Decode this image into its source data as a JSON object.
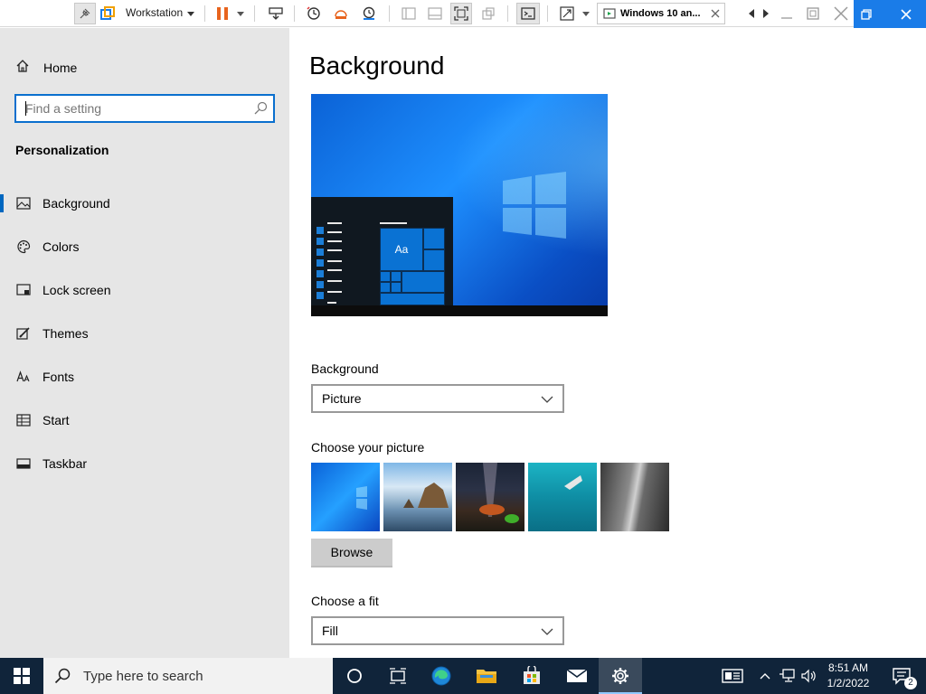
{
  "vmware": {
    "product_label": "Workstation",
    "vm_tab_title": "Windows 10 an..."
  },
  "sidebar": {
    "home_label": "Home",
    "search_placeholder": "Find a setting",
    "section_title": "Personalization",
    "items": [
      {
        "label": "Background",
        "icon": "picture-icon",
        "active": true
      },
      {
        "label": "Colors",
        "icon": "palette-icon",
        "active": false
      },
      {
        "label": "Lock screen",
        "icon": "lock-screen-icon",
        "active": false
      },
      {
        "label": "Themes",
        "icon": "brush-icon",
        "active": false
      },
      {
        "label": "Fonts",
        "icon": "fonts-icon",
        "active": false
      },
      {
        "label": "Start",
        "icon": "start-grid-icon",
        "active": false
      },
      {
        "label": "Taskbar",
        "icon": "taskbar-icon",
        "active": false
      }
    ]
  },
  "main": {
    "page_title": "Background",
    "preview_tile_label": "Aa",
    "background_label": "Background",
    "background_value": "Picture",
    "choose_picture_label": "Choose your picture",
    "browse_label": "Browse",
    "fit_label": "Choose a fit",
    "fit_value": "Fill"
  },
  "taskbar": {
    "search_placeholder": "Type here to search",
    "time": "8:51 AM",
    "date": "1/2/2022",
    "notification_count": "2"
  },
  "colors": {
    "accent": "#0067c0",
    "taskbar": "#10243a",
    "sidebar_bg": "#e6e6e6",
    "vmware_blue": "#1a7ce8"
  }
}
